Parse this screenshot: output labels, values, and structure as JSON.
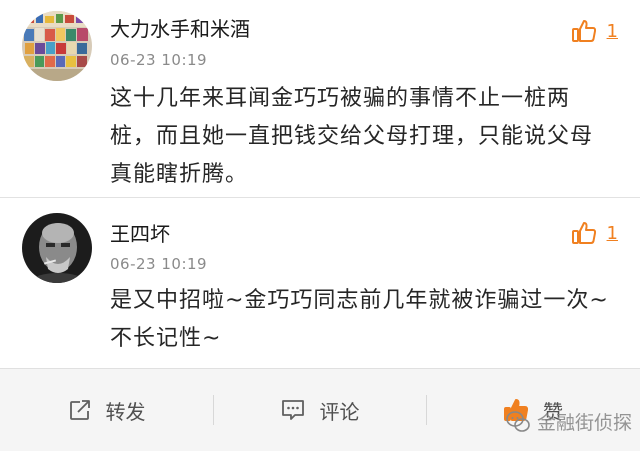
{
  "comments": [
    {
      "username": "大力水手和米酒",
      "timestamp": "06-23 10:19",
      "content": "这十几年来耳闻金巧巧被骗的事情不止一桩两桩，而且她一直把钱交给父母打理，只能说父母真能瞎折腾。",
      "like_count": "1",
      "avatar_icon": "colorful-collage-avatar",
      "like_icon": "thumbs-up-icon"
    },
    {
      "username": "王四坏",
      "timestamp": "06-23 10:19",
      "content": "是又中招啦~金巧巧同志前几年就被诈骗过一次~不长记性~",
      "like_count": "1",
      "avatar_icon": "bw-portrait-avatar",
      "like_icon": "thumbs-up-icon"
    }
  ],
  "actions": {
    "repost_label": "转发",
    "comment_label": "评论",
    "like_label": "赞"
  },
  "watermark": {
    "text": "金融街侦探"
  },
  "colors": {
    "accent_orange": "#f08020",
    "action_bar_bg": "#f5f5f5",
    "timestamp_gray": "#8a8a8a"
  }
}
